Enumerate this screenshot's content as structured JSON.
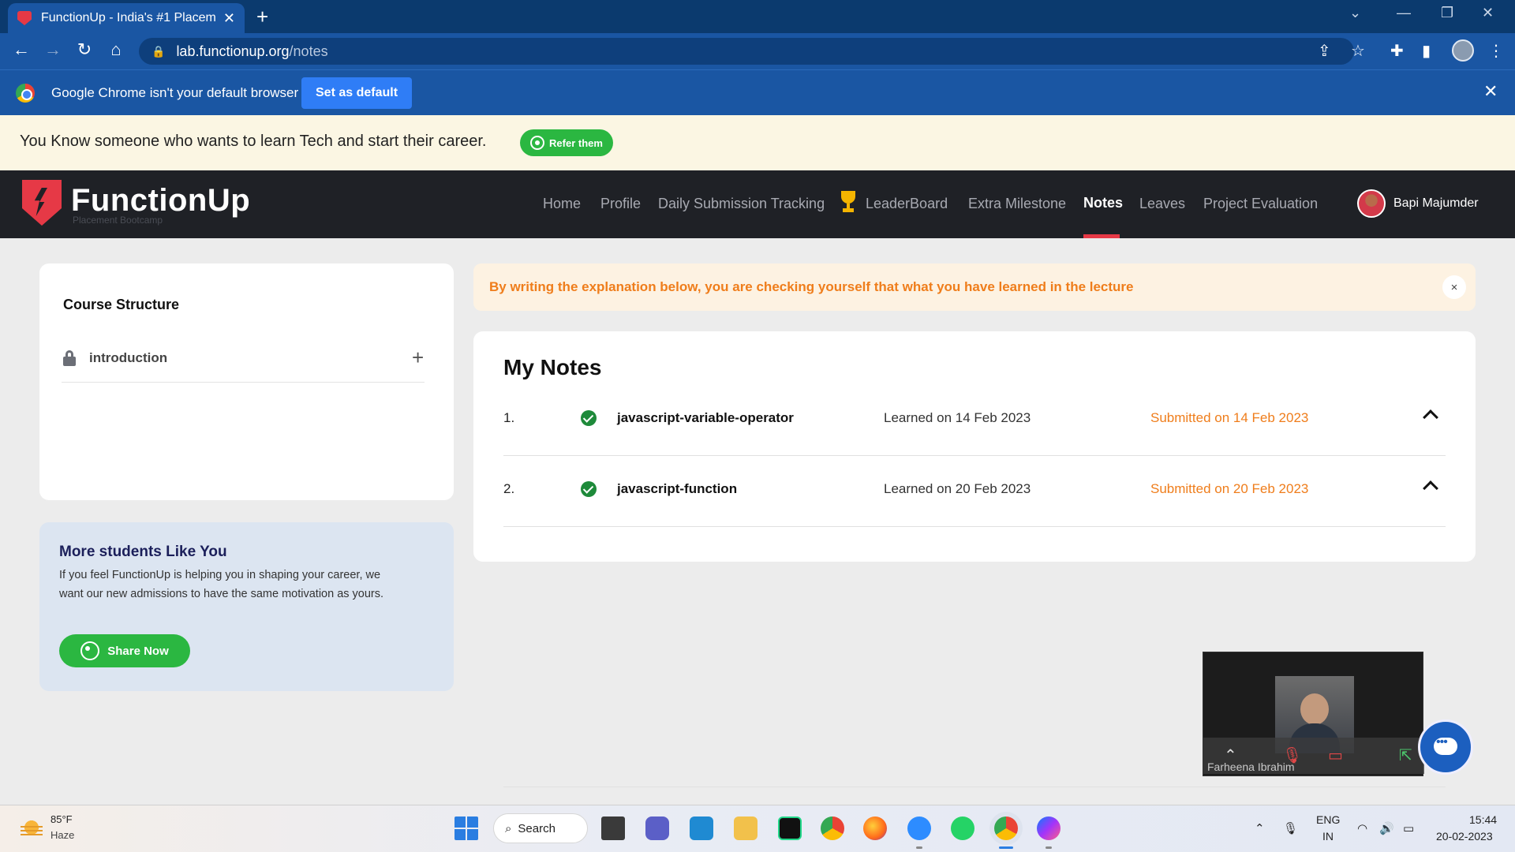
{
  "browser": {
    "tab_title": "FunctionUp - India's #1 Placeme",
    "url_host": "lab.functionup.org",
    "url_path": "/notes",
    "infobar_text": "Google Chrome isn't your default browser",
    "set_default_label": "Set as default"
  },
  "refer_banner": {
    "text": "You Know someone who wants to learn Tech and start their career.",
    "button_label": "Refer them"
  },
  "site": {
    "logo": "FunctionUp",
    "logo_sub": "Placement Bootcamp",
    "nav": {
      "home": "Home",
      "profile": "Profile",
      "daily": "Daily Submission Tracking",
      "leaderboard": "LeaderBoard",
      "extra": "Extra Milestone",
      "notes": "Notes",
      "leaves": "Leaves",
      "project": "Project Evaluation"
    },
    "user_name": "Bapi Majumder"
  },
  "course_structure": {
    "title": "Course Structure",
    "items": [
      {
        "label": "introduction"
      }
    ]
  },
  "more_students": {
    "title": "More students Like You",
    "text": "If you feel FunctionUp is helping you in shaping your career, we want our new admissions to have the same motivation as yours.",
    "button_label": "Share Now"
  },
  "alert": {
    "text": "By writing the explanation below, you are checking yourself that what you have learned in the lecture",
    "close": "×"
  },
  "notes": {
    "title": "My Notes",
    "rows": [
      {
        "num": "1.",
        "name": "javascript-variable-operator",
        "learned": "Learned on 14 Feb 2023",
        "submitted": "Submitted on 14 Feb 2023"
      },
      {
        "num": "2.",
        "name": "javascript-function",
        "learned": "Learned on 20 Feb 2023",
        "submitted": "Submitted on 20 Feb 2023"
      }
    ]
  },
  "video_call": {
    "participant": "Farheena Ibrahim"
  },
  "taskbar": {
    "temp": "85°F",
    "condition": "Haze",
    "search_label": "Search",
    "lang_1": "ENG",
    "lang_2": "IN",
    "time": "15:44",
    "date": "20-02-2023"
  },
  "colors": {
    "accent_red": "#e63946",
    "whatsapp_green": "#2bb741",
    "alert_orange": "#ef7d1b",
    "header_dark": "#1f2126"
  }
}
